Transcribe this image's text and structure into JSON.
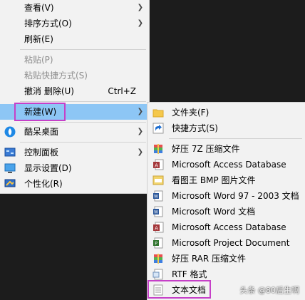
{
  "main_menu": {
    "view": "查看(V)",
    "sort": "排序方式(O)",
    "refresh": "刷新(E)",
    "paste": "粘贴(P)",
    "paste_shortcut": "粘贴快捷方式(S)",
    "undo": "撤消 删除(U)",
    "undo_shortcut": "Ctrl+Z",
    "new": "新建(W)",
    "kudesk": "酷呆桌面",
    "control_panel": "控制面板",
    "display": "显示设置(D)",
    "personalize": "个性化(R)"
  },
  "new_submenu": {
    "folder": "文件夹(F)",
    "shortcut": "快捷方式(S)",
    "haozip7z": "好压 7Z 压缩文件",
    "access1": "Microsoft Access Database",
    "kantu_bmp": "看图王 BMP 图片文件",
    "word97": "Microsoft Word 97 - 2003 文档",
    "word": "Microsoft Word 文档",
    "access2": "Microsoft Access Database",
    "project": "Microsoft Project Document",
    "haozip_rar": "好压 RAR 压缩文件",
    "rtf": "RTF 格式",
    "text": "文本文档"
  },
  "watermark": "头条 @80后生啊",
  "colors": {
    "highlight": "#8dc6f5",
    "annotation": "#c640c8",
    "menu_bg": "#f2f2f2"
  }
}
